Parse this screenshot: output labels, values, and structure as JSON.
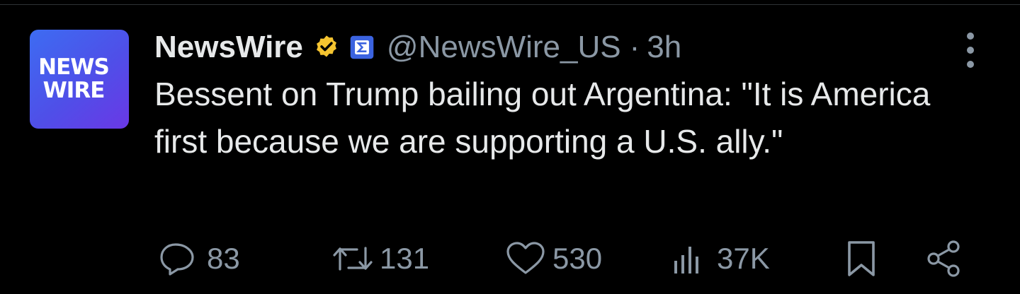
{
  "post": {
    "avatar_text": [
      "NEWS",
      "WIRE"
    ],
    "display_name": "NewsWire",
    "handle": "@NewsWire_US",
    "separator": "·",
    "time": "3h",
    "text": "Bessent on Trump bailing out Argentina: \"It is America first because we are supporting a U.S. ally.\"",
    "badges": {
      "verified_color": "#f5c430",
      "affiliation_color": "#3b63e0"
    }
  },
  "actions": {
    "replies": "83",
    "reposts": "131",
    "likes": "530",
    "views": "37K"
  },
  "icons": [
    "verified-badge-icon",
    "affiliation-icon",
    "more-icon",
    "reply-icon",
    "repost-icon",
    "like-icon",
    "views-icon",
    "bookmark-icon",
    "share-icon"
  ]
}
